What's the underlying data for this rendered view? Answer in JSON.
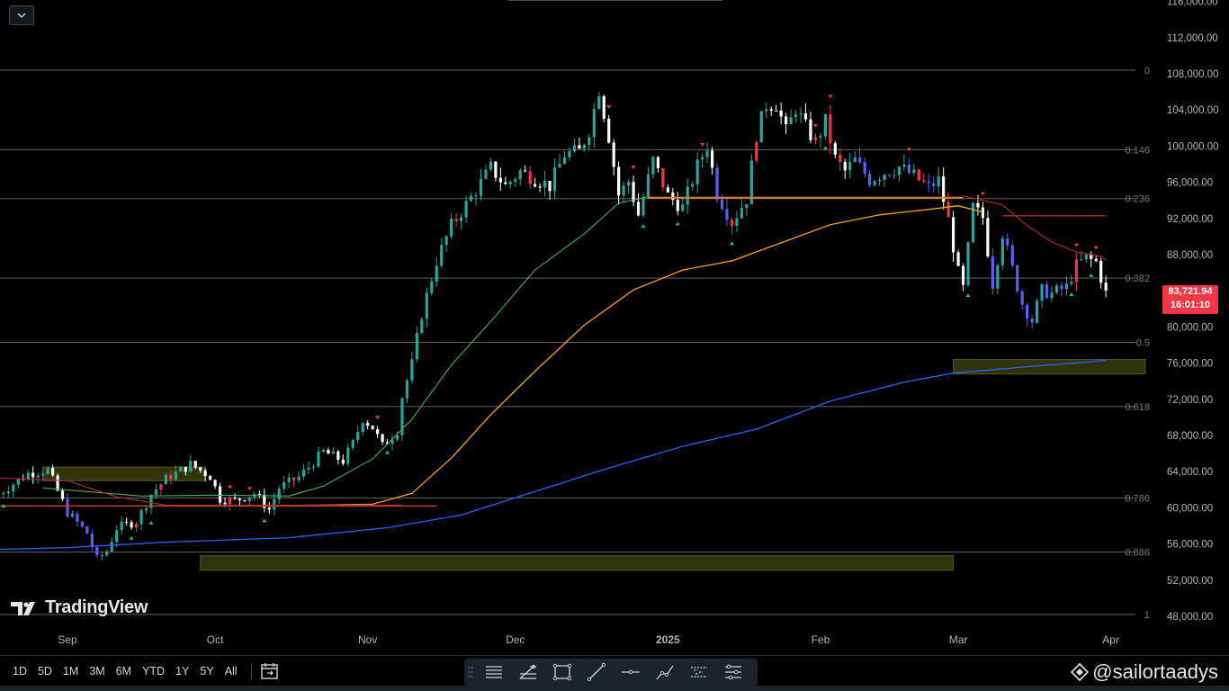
{
  "chart_data": {
    "type": "candlestick",
    "y_axis": {
      "range": [
        46500,
        117000
      ],
      "ticks": [
        48000,
        52000,
        56000,
        60000,
        64000,
        68000,
        72000,
        76000,
        80000,
        84000,
        88000,
        92000,
        96000,
        100000,
        104000,
        108000,
        112000,
        116000
      ],
      "tick_labels": [
        "48,000.00",
        "52,000.00",
        "56,000.00",
        "60,000.00",
        "64,000.00",
        "68,000.00",
        "72,000.00",
        "76,000.00",
        "80,000.00",
        "84,000.00",
        "88,000.00",
        "92,000.00",
        "96,000.00",
        "100,000.00",
        "104,000.00",
        "108,000.00",
        "112,000.00",
        "116,000.00"
      ]
    },
    "x_axis": {
      "range_days": [
        -5,
        212
      ],
      "labels": [
        {
          "text": "Sep",
          "day": 0
        },
        {
          "text": "Oct",
          "day": 30
        },
        {
          "text": "Nov",
          "day": 61
        },
        {
          "text": "Dec",
          "day": 91
        },
        {
          "text": "2025",
          "day": 122
        },
        {
          "text": "Feb",
          "day": 153
        },
        {
          "text": "Mar",
          "day": 181
        },
        {
          "text": "Apr",
          "day": 212
        }
      ]
    },
    "fib_levels": [
      {
        "label": "0",
        "price": 108400
      },
      {
        "label": "0.146",
        "price": 99600
      },
      {
        "label": "0.236",
        "price": 94200
      },
      {
        "label": "0.382",
        "price": 85400
      },
      {
        "label": "0.5",
        "price": 78300
      },
      {
        "label": "0.618",
        "price": 71200
      },
      {
        "label": "0.786",
        "price": 61100
      },
      {
        "label": "0.886",
        "price": 55100
      },
      {
        "label": "1",
        "price": 48200
      }
    ],
    "zones": [
      {
        "day_start": -5,
        "day_end": 28,
        "low": 63000,
        "high": 64500
      },
      {
        "day_start": 27,
        "day_end": 180,
        "low": 53100,
        "high": 54700
      },
      {
        "day_start": 180,
        "day_end": 219,
        "low": 74800,
        "high": 76400
      }
    ],
    "current_price": "83,721.94",
    "countdown": "16:01:10",
    "colors": {
      "up_candle": "#26a69a",
      "down_candle": "#ffffff",
      "blue_candle": "#5b5ff5",
      "red_candle": "#f23645",
      "fib_line": "#787b86",
      "ma_blue": "#2962ff",
      "ma_orange": "#f7a21b",
      "ma_green": "#4caf50",
      "ma_red": "#b22833",
      "zone_fill": "#3a3d10",
      "price_tag": "#f23645"
    }
  },
  "timeframes": [
    "1D",
    "5D",
    "1M",
    "3M",
    "6M",
    "YTD",
    "1Y",
    "5Y",
    "All"
  ],
  "watermark": "TradingView",
  "author_handle": "@sailortaadys",
  "drawing_tools": [
    "parallel-channel-icon",
    "fib-icon",
    "rectangle-icon",
    "trend-line-icon",
    "horizontal-line-icon",
    "path-icon",
    "measure-icon",
    "settings-lines-icon"
  ]
}
